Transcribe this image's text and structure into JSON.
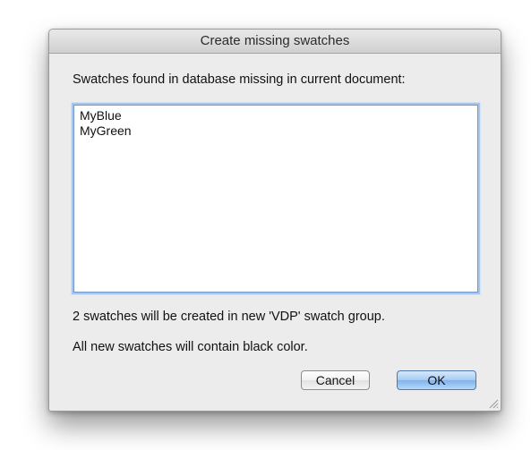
{
  "dialog": {
    "title": "Create missing swatches",
    "prompt": "Swatches found in database missing in current document:",
    "swatches": [
      "MyBlue",
      "MyGreen"
    ],
    "info_created": "2 swatches will be created in new 'VDP' swatch group.",
    "info_color": "All new swatches will contain black color.",
    "cancel_label": "Cancel",
    "ok_label": "OK"
  },
  "colors": {
    "default_button": "#7fb3ec",
    "focus_ring": "#a6c6ec"
  },
  "icons": {
    "resize": "resize-grip-icon"
  }
}
